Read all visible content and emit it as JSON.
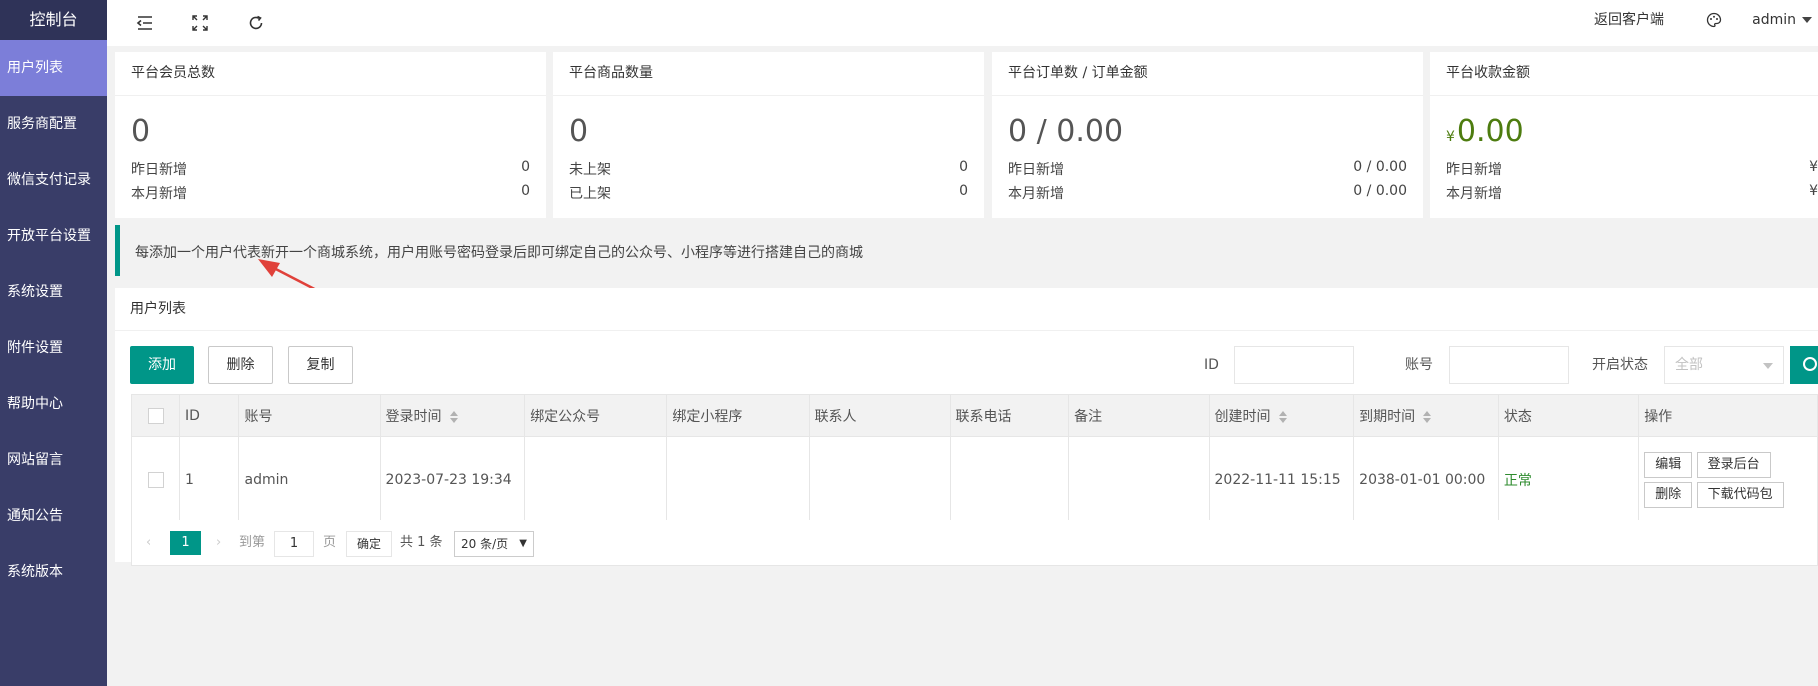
{
  "sidebar": {
    "brand": "控制台",
    "items": [
      {
        "label": "用户列表",
        "active": true
      },
      {
        "label": "服务商配置"
      },
      {
        "label": "微信支付记录"
      },
      {
        "label": "开放平台设置"
      },
      {
        "label": "系统设置"
      },
      {
        "label": "附件设置"
      },
      {
        "label": "帮助中心"
      },
      {
        "label": "网站留言"
      },
      {
        "label": "通知公告"
      },
      {
        "label": "系统版本"
      }
    ]
  },
  "header": {
    "icons": [
      "menu-fold-icon",
      "fullscreen-icon",
      "refresh-icon",
      "palette-icon"
    ],
    "back_link": "返回客户端",
    "user": "admin"
  },
  "cards": [
    {
      "title": "平台会员总数",
      "value": "0",
      "rows": [
        {
          "label": "昨日新增",
          "value": "0"
        },
        {
          "label": "本月新增",
          "value": "0"
        }
      ]
    },
    {
      "title": "平台商品数量",
      "value": "0",
      "rows": [
        {
          "label": "未上架",
          "value": "0"
        },
        {
          "label": "已上架",
          "value": "0"
        }
      ]
    },
    {
      "title": "平台订单数 / 订单金额",
      "value": "0 / 0.00",
      "rows": [
        {
          "label": "昨日新增",
          "value": "0 / 0.00"
        },
        {
          "label": "本月新增",
          "value": "0 / 0.00"
        }
      ]
    },
    {
      "title": "平台收款金额",
      "currency": "¥",
      "value": "0.00",
      "rows": [
        {
          "label": "昨日新增",
          "value": "¥"
        },
        {
          "label": "本月新增",
          "value": "¥"
        }
      ]
    }
  ],
  "notice": "每添加一个用户代表新开一个商城系统，用户用账号密码登录后即可绑定自己的公众号、小程序等进行搭建自己的商城",
  "panel": {
    "title": "用户列表",
    "buttons": {
      "add": "添加",
      "delete": "删除",
      "copy": "复制"
    },
    "filters": {
      "id_label": "ID",
      "account_label": "账号",
      "status_label": "开启状态",
      "status_placeholder": "全部"
    }
  },
  "table": {
    "columns": [
      "ID",
      "账号",
      "登录时间",
      "绑定公众号",
      "绑定小程序",
      "联系人",
      "联系电话",
      "备注",
      "创建时间",
      "到期时间",
      "状态",
      "操作"
    ],
    "rows": [
      {
        "id": "1",
        "account": "admin",
        "login_time": "2023-07-23 19:34",
        "wechat": "",
        "miniapp": "",
        "contact": "",
        "phone": "",
        "remark": "",
        "created": "2022-11-11 15:15",
        "expire": "2038-01-01 00:00",
        "status": "正常"
      }
    ],
    "row_actions": {
      "edit": "编辑",
      "login": "登录后台",
      "delete": "删除",
      "download": "下载代码包"
    }
  },
  "pager": {
    "current": "1",
    "goto_label": "到第",
    "goto_value": "1",
    "page_unit": "页",
    "confirm": "确定",
    "total": "共 1 条",
    "per_page": "20 条/页"
  },
  "colors": {
    "primary": "#009688",
    "sidebar": "#393d68",
    "sidebar_active": "#7c7ed9",
    "money": "#4d7c0f",
    "annotation": "#e0413a"
  }
}
